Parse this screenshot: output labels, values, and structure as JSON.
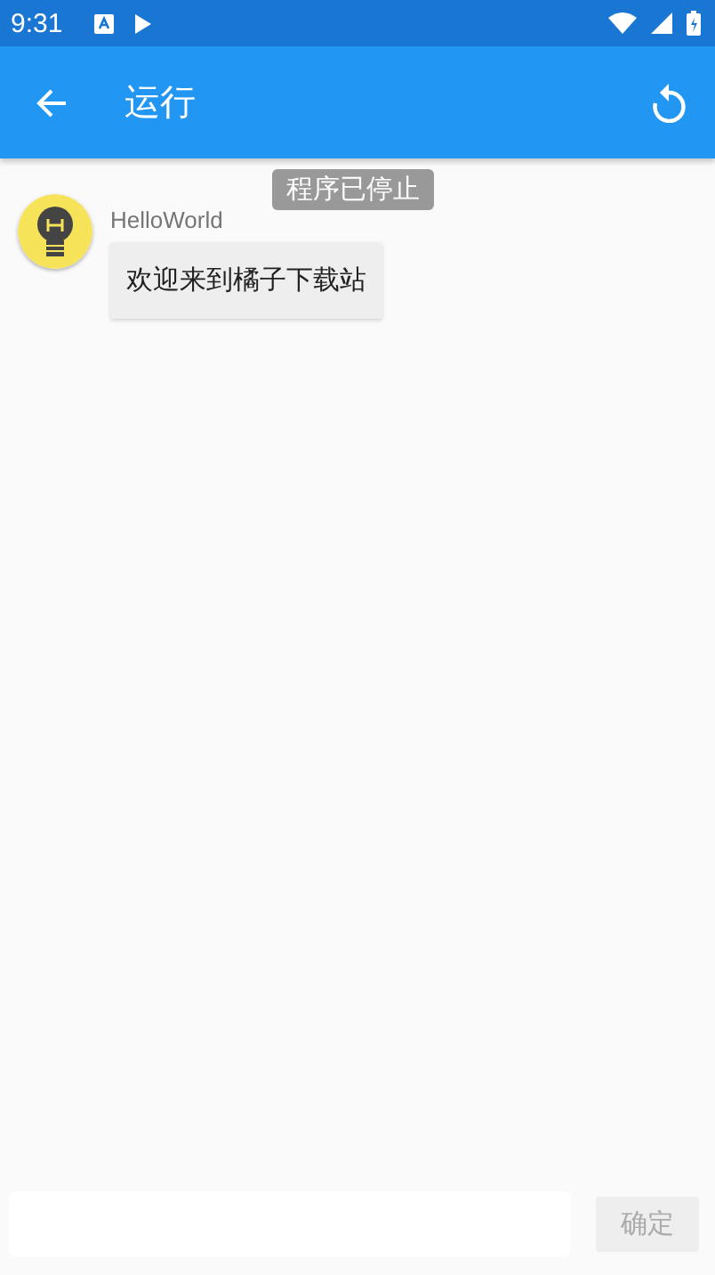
{
  "status_bar": {
    "time": "9:31"
  },
  "toolbar": {
    "title": "运行"
  },
  "toast": {
    "text": "程序已停止"
  },
  "messages": [
    {
      "sender": "HelloWorld",
      "text": "欢迎来到橘子下载站"
    }
  ],
  "input_bar": {
    "button": {
      "label": "确定",
      "disabled": true
    }
  }
}
